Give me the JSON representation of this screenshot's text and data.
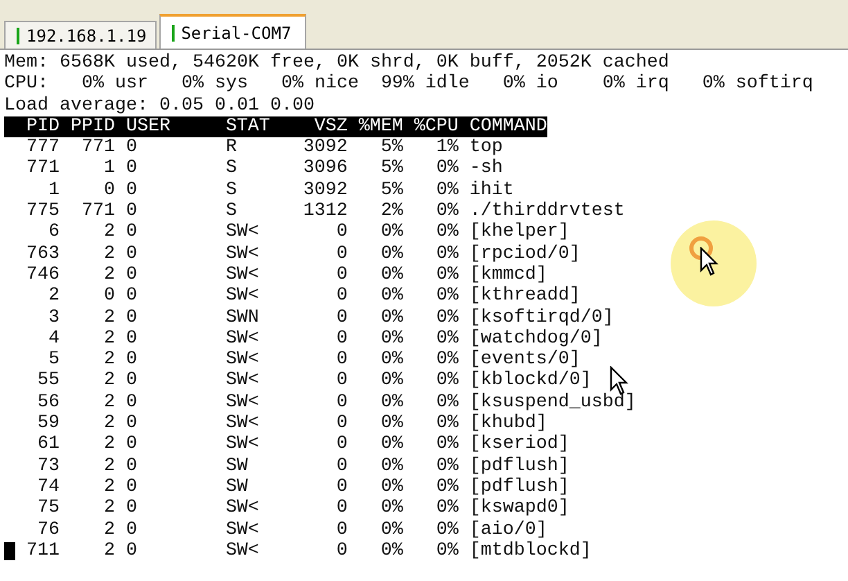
{
  "tabs": [
    {
      "label": "192.168.1.19",
      "selected": false
    },
    {
      "label": "Serial-COM7",
      "selected": true
    }
  ],
  "terminal": {
    "summary": [
      "Mem: 6568K used, 54620K free, 0K shrd, 0K buff, 2052K cached",
      "CPU:   0% usr   0% sys   0% nice  99% idle   0% io    0% irq   0% softirq",
      "Load average: 0.05 0.01 0.00"
    ],
    "columns": [
      "PID",
      "PPID",
      "USER",
      "STAT",
      "VSZ",
      "%MEM",
      "%CPU",
      "COMMAND"
    ],
    "processes": [
      {
        "pid": "777",
        "ppid": "771",
        "user": "0",
        "stat": "R",
        "vsz": "3092",
        "mem": "5%",
        "cpu": "1%",
        "command": "top",
        "cursor": false
      },
      {
        "pid": "771",
        "ppid": "1",
        "user": "0",
        "stat": "S",
        "vsz": "3096",
        "mem": "5%",
        "cpu": "0%",
        "command": "-sh",
        "cursor": false
      },
      {
        "pid": "1",
        "ppid": "0",
        "user": "0",
        "stat": "S",
        "vsz": "3092",
        "mem": "5%",
        "cpu": "0%",
        "command": "ihit",
        "cursor": false
      },
      {
        "pid": "775",
        "ppid": "771",
        "user": "0",
        "stat": "S",
        "vsz": "1312",
        "mem": "2%",
        "cpu": "0%",
        "command": "./thirddrvtest",
        "cursor": false
      },
      {
        "pid": "6",
        "ppid": "2",
        "user": "0",
        "stat": "SW<",
        "vsz": "0",
        "mem": "0%",
        "cpu": "0%",
        "command": "[khelper]",
        "cursor": false
      },
      {
        "pid": "763",
        "ppid": "2",
        "user": "0",
        "stat": "SW<",
        "vsz": "0",
        "mem": "0%",
        "cpu": "0%",
        "command": "[rpciod/0]",
        "cursor": false
      },
      {
        "pid": "746",
        "ppid": "2",
        "user": "0",
        "stat": "SW<",
        "vsz": "0",
        "mem": "0%",
        "cpu": "0%",
        "command": "[kmmcd]",
        "cursor": false
      },
      {
        "pid": "2",
        "ppid": "0",
        "user": "0",
        "stat": "SW<",
        "vsz": "0",
        "mem": "0%",
        "cpu": "0%",
        "command": "[kthreadd]",
        "cursor": false
      },
      {
        "pid": "3",
        "ppid": "2",
        "user": "0",
        "stat": "SWN",
        "vsz": "0",
        "mem": "0%",
        "cpu": "0%",
        "command": "[ksoftirqd/0]",
        "cursor": false
      },
      {
        "pid": "4",
        "ppid": "2",
        "user": "0",
        "stat": "SW<",
        "vsz": "0",
        "mem": "0%",
        "cpu": "0%",
        "command": "[watchdog/0]",
        "cursor": false
      },
      {
        "pid": "5",
        "ppid": "2",
        "user": "0",
        "stat": "SW<",
        "vsz": "0",
        "mem": "0%",
        "cpu": "0%",
        "command": "[events/0]",
        "cursor": false
      },
      {
        "pid": "55",
        "ppid": "2",
        "user": "0",
        "stat": "SW<",
        "vsz": "0",
        "mem": "0%",
        "cpu": "0%",
        "command": "[kblockd/0]",
        "cursor": false
      },
      {
        "pid": "56",
        "ppid": "2",
        "user": "0",
        "stat": "SW<",
        "vsz": "0",
        "mem": "0%",
        "cpu": "0%",
        "command": "[ksuspend_usbd]",
        "cursor": false
      },
      {
        "pid": "59",
        "ppid": "2",
        "user": "0",
        "stat": "SW<",
        "vsz": "0",
        "mem": "0%",
        "cpu": "0%",
        "command": "[khubd]",
        "cursor": false
      },
      {
        "pid": "61",
        "ppid": "2",
        "user": "0",
        "stat": "SW<",
        "vsz": "0",
        "mem": "0%",
        "cpu": "0%",
        "command": "[kseriod]",
        "cursor": false
      },
      {
        "pid": "73",
        "ppid": "2",
        "user": "0",
        "stat": "SW",
        "vsz": "0",
        "mem": "0%",
        "cpu": "0%",
        "command": "[pdflush]",
        "cursor": false
      },
      {
        "pid": "74",
        "ppid": "2",
        "user": "0",
        "stat": "SW",
        "vsz": "0",
        "mem": "0%",
        "cpu": "0%",
        "command": "[pdflush]",
        "cursor": false
      },
      {
        "pid": "75",
        "ppid": "2",
        "user": "0",
        "stat": "SW<",
        "vsz": "0",
        "mem": "0%",
        "cpu": "0%",
        "command": "[kswapd0]",
        "cursor": false
      },
      {
        "pid": "76",
        "ppid": "2",
        "user": "0",
        "stat": "SW<",
        "vsz": "0",
        "mem": "0%",
        "cpu": "0%",
        "command": "[aio/0]",
        "cursor": false
      },
      {
        "pid": "711",
        "ppid": "2",
        "user": "0",
        "stat": "SW<",
        "vsz": "0",
        "mem": "0%",
        "cpu": "0%",
        "command": "[mtdblockd]",
        "cursor": true
      }
    ]
  }
}
